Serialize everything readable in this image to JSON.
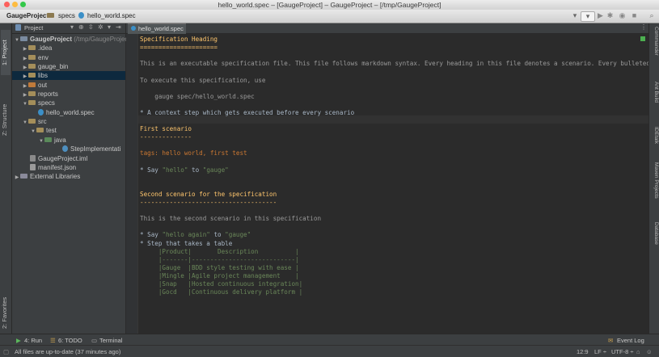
{
  "window": {
    "title": "hello_world.spec – [GaugeProject] – GaugeProject – [/tmp/GaugeProject]"
  },
  "breadcrumbs": [
    "GaugeProject",
    "specs",
    "hello_world.spec"
  ],
  "project_panel": {
    "selector": "Project"
  },
  "left_tool_tabs": {
    "project": "1: Project",
    "structure": "Z: Structure",
    "favorites": "2: Favorites"
  },
  "right_tool_tabs": [
    "Commander",
    "Ant Build",
    "IDEtalk",
    "Maven Projects",
    "Database"
  ],
  "tree": [
    {
      "label": "GaugeProject",
      "suffix": "(/tmp/GaugeProject)",
      "type": "module"
    },
    {
      "label": ".idea",
      "type": "folder"
    },
    {
      "label": "env",
      "type": "folder"
    },
    {
      "label": "gauge_bin",
      "type": "folder"
    },
    {
      "label": "libs",
      "type": "folder"
    },
    {
      "label": "out",
      "type": "folder-excluded"
    },
    {
      "label": "reports",
      "type": "folder"
    },
    {
      "label": "specs",
      "type": "folder"
    },
    {
      "label": "hello_world.spec",
      "type": "spec-file"
    },
    {
      "label": "src",
      "type": "folder"
    },
    {
      "label": "test",
      "type": "folder"
    },
    {
      "label": "java",
      "type": "folder-source"
    },
    {
      "label": "StepImplementati",
      "type": "java-class"
    },
    {
      "label": "GaugeProject.iml",
      "type": "iml-file"
    },
    {
      "label": "manifest.json",
      "type": "json-file"
    },
    {
      "label": "External Libraries",
      "type": "libraries"
    }
  ],
  "editor": {
    "tab": "hello_world.spec",
    "lines": [
      {
        "text": "Specification Heading",
        "style": "head"
      },
      {
        "text": "=====================",
        "style": "head"
      },
      {
        "text": "",
        "style": "plain"
      },
      {
        "text": "This is an executable specification file. This file follows markdown syntax. Every heading in this file denotes a scenario. Every bulleted point de",
        "style": "dim"
      },
      {
        "text": "",
        "style": "plain"
      },
      {
        "text": "To execute this specification, use",
        "style": "dim"
      },
      {
        "text": "",
        "style": "plain"
      },
      {
        "text": "    gauge spec/hello_world.spec",
        "style": "dim"
      },
      {
        "text": "",
        "style": "plain"
      },
      {
        "text": "* A context step which gets executed before every scenario",
        "style": "plain"
      },
      {
        "text": "",
        "style": "plain"
      },
      {
        "text": "First scenario",
        "style": "head"
      },
      {
        "text": "--------------",
        "style": "head"
      },
      {
        "text": "",
        "style": "plain"
      },
      {
        "text": "tags: hello world, first test",
        "style": "tag"
      },
      {
        "text": "",
        "style": "plain"
      },
      {
        "text": "* Say ",
        "style": "plain",
        "parts": [
          "* Say ",
          "\"hello\"",
          " to ",
          "\"gauge\""
        ]
      },
      {
        "text": "",
        "style": "plain"
      },
      {
        "text": "",
        "style": "plain"
      },
      {
        "text": "Second scenario for the specification",
        "style": "head"
      },
      {
        "text": "-------------------------------------",
        "style": "head"
      },
      {
        "text": "",
        "style": "plain"
      },
      {
        "text": "This is the second scenario in this specification",
        "style": "dim"
      },
      {
        "text": "",
        "style": "plain"
      },
      {
        "text": "* Say ",
        "style": "plain",
        "parts": [
          "* Say ",
          "\"hello again\"",
          " to ",
          "\"gauge\""
        ]
      },
      {
        "text": "* Step that takes a table",
        "style": "plain"
      },
      {
        "text": "     |Product|       Description          |",
        "style": "tbl"
      },
      {
        "text": "     |-------|----------------------------|",
        "style": "tbl"
      },
      {
        "text": "     |Gauge  |BDD style testing with ease |",
        "style": "tbl"
      },
      {
        "text": "     |Mingle |Agile project management    |",
        "style": "tbl"
      },
      {
        "text": "     |Snap   |Hosted continuous integration|",
        "style": "tbl"
      },
      {
        "text": "     |Gocd   |Continuous delivery platform |",
        "style": "tbl"
      }
    ]
  },
  "bottom_tabs": {
    "run": "4: Run",
    "todo": "6: TODO",
    "terminal": "Terminal",
    "event_log": "Event Log"
  },
  "status": {
    "message": "All files are up-to-date (37 minutes ago)",
    "position": "12:9",
    "line_sep": "LF ÷",
    "encoding": "UTF-8 ÷"
  },
  "colors": {
    "heading": "#ffc66d",
    "string": "#6a8759",
    "tag": "#cc7832",
    "selected": "#0d293e"
  }
}
